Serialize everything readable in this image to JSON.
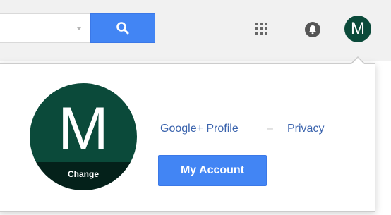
{
  "search": {
    "value": "",
    "placeholder": ""
  },
  "icons": {
    "search": "search-icon",
    "apps": "apps-grid-icon",
    "notifications": "bell-icon",
    "dropdown_caret": "caret-down-icon"
  },
  "account": {
    "initial": "M",
    "change_label": "Change",
    "profile_link": "Google+ Profile",
    "separator": "–",
    "privacy_link": "Privacy",
    "my_account_button": "My Account"
  },
  "colors": {
    "accent_blue": "#4285f4",
    "avatar_bg": "#0b4a3a",
    "link": "#3a63ad",
    "topbar_bg": "#f1f1f1"
  }
}
